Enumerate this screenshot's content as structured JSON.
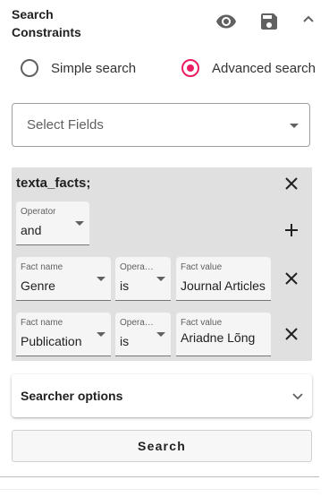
{
  "header": {
    "title": "Search Constraints",
    "icons": [
      "eye-icon",
      "save-icon",
      "chevron-up-icon"
    ]
  },
  "search_mode": {
    "simple_label": "Simple search",
    "advanced_label": "Advanced search",
    "selected": "advanced",
    "accent_color": "#e91e63"
  },
  "select_fields": {
    "placeholder": "Select Fields"
  },
  "constraint": {
    "title": "texta_facts;",
    "operator": {
      "label": "Operator",
      "value": "and"
    },
    "rows": [
      {
        "fact_name_label": "Fact name",
        "fact_name": "Genre",
        "operator_label": "Opera…",
        "operator": "is",
        "fact_value_label": "Fact value",
        "fact_value": "Journal Articles"
      },
      {
        "fact_name_label": "Fact name",
        "fact_name": "Publication",
        "operator_label": "Opera…",
        "operator": "is",
        "fact_value_label": "Fact value",
        "fact_value": "Ariadne Lõng"
      }
    ]
  },
  "searcher_options": {
    "label": "Searcher options"
  },
  "search_button": {
    "label": "Search"
  }
}
